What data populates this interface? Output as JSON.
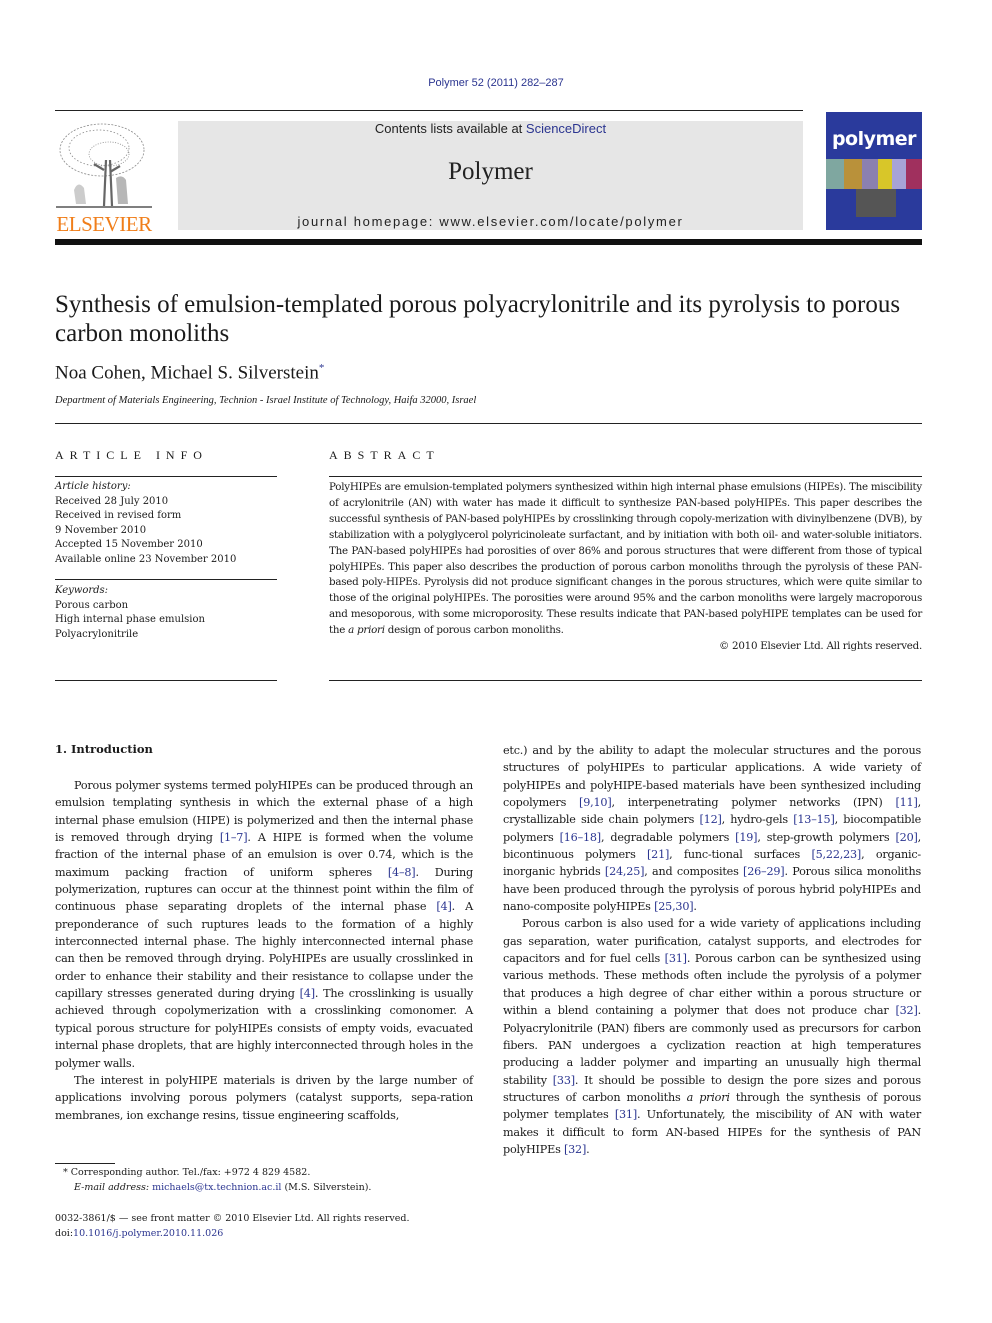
{
  "header": {
    "journal_ref": "Polymer 52 (2011) 282–287",
    "contents_prefix": "Contents lists available at ",
    "contents_link": "ScienceDirect",
    "journal_title": "Polymer",
    "homepage": "journal homepage: www.elsevier.com/locate/polymer",
    "publisher_logo_text": "ELSEVIER",
    "cover_title": "polymer",
    "colors": {
      "link": "#2b3590",
      "elsevier_orange": "#f07e1a",
      "cover_blue": "#2a3a9c",
      "banner_bg": "#e6e6e6"
    }
  },
  "article": {
    "title": "Synthesis of emulsion-templated porous polyacrylonitrile and its pyrolysis to porous carbon monoliths",
    "authors": "Noa Cohen, Michael S. Silverstein",
    "author_mark": "*",
    "affiliation": "Department of Materials Engineering, Technion - Israel Institute of Technology, Haifa 32000, Israel"
  },
  "article_info": {
    "heading": "ARTICLE INFO",
    "history_label": "Article history:",
    "history": [
      "Received 28 July 2010",
      "Received in revised form",
      "9 November 2010",
      "Accepted 15 November 2010",
      "Available online 23 November 2010"
    ],
    "keywords_label": "Keywords:",
    "keywords": [
      "Porous carbon",
      "High internal phase emulsion",
      "Polyacrylonitrile"
    ]
  },
  "abstract": {
    "heading": "ABSTRACT",
    "text_1": "PolyHIPEs are emulsion-templated polymers synthesized within high internal phase emulsions (HIPEs). The miscibility of acrylonitrile (AN) with water has made it difficult to synthesize PAN-based polyHIPEs. This paper describes the successful synthesis of PAN-based polyHIPEs by crosslinking through copoly-merization with divinylbenzene (DVB), by stabilization with a polyglycerol polyricinoleate surfactant, and by initiation with both oil- and water-soluble initiators. The PAN-based polyHIPEs had porosities of over 86% and porous structures that were different from those of typical polyHIPEs. This paper also describes the production of porous carbon monoliths through the pyrolysis of these PAN-based poly-HIPEs. Pyrolysis did not produce significant changes in the porous structures, which were quite similar to those of the original polyHIPEs. The porosities were around 95% and the carbon monoliths were largely macroporous and mesoporous, with some microporosity. These results indicate that PAN-based polyHIPE templates can be used for the ",
    "text_italic": "a priori",
    "text_2": " design of porous carbon monoliths.",
    "copyright": "© 2010 Elsevier Ltd. All rights reserved."
  },
  "intro": {
    "heading": "1.  Introduction",
    "p1": [
      {
        "t": "Porous polymer systems termed polyHIPEs can be produced through an emulsion templating synthesis in which the external phase of a high internal phase emulsion (HIPE) is polymerized and then the internal phase is removed through drying "
      },
      {
        "ref": "[1–7]"
      },
      {
        "t": ". A HIPE is formed when the volume fraction of the internal phase of an emulsion is over 0.74, which is the maximum packing fraction of uniform spheres "
      },
      {
        "ref": "[4–8]"
      },
      {
        "t": ". During polymerization, ruptures can occur at the thinnest point within the film of continuous phase separating droplets of the internal phase "
      },
      {
        "ref": "[4]"
      },
      {
        "t": ". A preponderance of such ruptures leads to the formation of a highly interconnected internal phase. The highly interconnected internal phase can then be removed through drying. PolyHIPEs are usually crosslinked in order to enhance their stability and their resistance to collapse under the capillary stresses generated during drying "
      },
      {
        "ref": "[4]"
      },
      {
        "t": ". The crosslinking is usually achieved through copolymerization with a crosslinking comonomer. A typical porous structure for polyHIPEs consists of empty voids, evacuated internal phase droplets, that are highly interconnected through holes in the polymer walls."
      }
    ],
    "p2": [
      {
        "t": "The interest in polyHIPE materials is driven by the large number of applications involving porous polymers (catalyst supports, sepa-ration membranes, ion exchange resins, tissue engineering scaffolds, etc.) and by the ability to adapt the molecular structures and the porous structures of polyHIPEs to particular applications. A wide variety of polyHIPEs and polyHIPE-based materials have been synthesized including copolymers "
      },
      {
        "ref": "[9,10]"
      },
      {
        "t": ", interpenetrating polymer networks (IPN) "
      },
      {
        "ref": "[11]"
      },
      {
        "t": ", crystallizable side chain polymers "
      },
      {
        "ref": "[12]"
      },
      {
        "t": ", hydro-gels "
      },
      {
        "ref": "[13–15]"
      },
      {
        "t": ", biocompatible polymers "
      },
      {
        "ref": "[16–18]"
      },
      {
        "t": ", degradable polymers "
      },
      {
        "ref": "[19]"
      },
      {
        "t": ", step-growth polymers "
      },
      {
        "ref": "[20]"
      },
      {
        "t": ", bicontinuous polymers "
      },
      {
        "ref": "[21]"
      },
      {
        "t": ", func-tional surfaces "
      },
      {
        "ref": "[5,22,23]"
      },
      {
        "t": ", organic-inorganic hybrids "
      },
      {
        "ref": "[24,25]"
      },
      {
        "t": ", and composites "
      },
      {
        "ref": "[26–29]"
      },
      {
        "t": ". Porous silica monoliths have been produced through the pyrolysis of porous hybrid polyHIPEs and nano-composite polyHIPEs "
      },
      {
        "ref": "[25,30]"
      },
      {
        "t": "."
      }
    ],
    "p3": [
      {
        "t": "Porous carbon is also used for a wide variety of applications including gas separation, water purification, catalyst supports, and electrodes for capacitors and for fuel cells "
      },
      {
        "ref": "[31]"
      },
      {
        "t": ". Porous carbon can be synthesized using various methods. These methods often include the pyrolysis of a polymer that produces a high degree of char either within a porous structure or within a blend containing a polymer that does not produce char "
      },
      {
        "ref": "[32]"
      },
      {
        "t": ". Polyacrylonitrile (PAN) fibers are commonly used as precursors for carbon fibers. PAN undergoes a cyclization reaction at high temperatures producing a ladder polymer and imparting an unusually high thermal stability "
      },
      {
        "ref": "[33]"
      },
      {
        "t": ". It should be possible to design the pore sizes and porous structures of carbon monoliths "
      },
      {
        "i": "a priori"
      },
      {
        "t": " through the synthesis of porous polymer templates "
      },
      {
        "ref": "[31]"
      },
      {
        "t": ". Unfortunately, the miscibility of AN with water makes it difficult to form AN-based HIPEs for the synthesis of PAN polyHIPEs "
      },
      {
        "ref": "[32]"
      },
      {
        "t": "."
      }
    ]
  },
  "footnote": {
    "star_line": "*  Corresponding author. Tel./fax: +972 4 829 4582.",
    "email_label": "E-mail address: ",
    "email": "michaels@tx.technion.ac.il",
    "email_suffix": " (M.S. Silverstein).",
    "issn_line": "0032-3861/$ — see front matter © 2010 Elsevier Ltd. All rights reserved.",
    "doi_prefix": "doi:",
    "doi": "10.1016/j.polymer.2010.11.026"
  }
}
